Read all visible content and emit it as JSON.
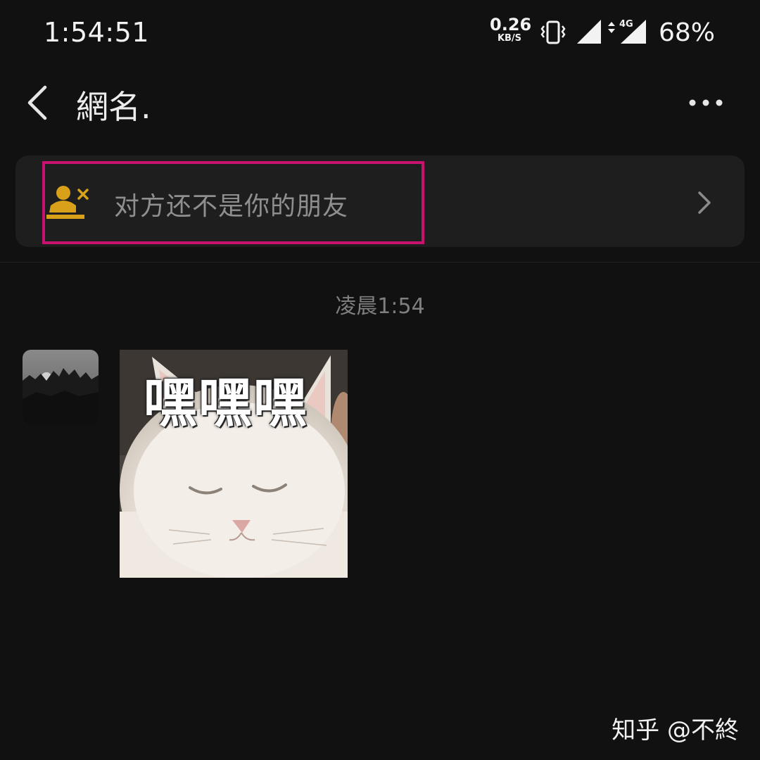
{
  "status_bar": {
    "time": "1:54:51",
    "net_speed_value": "0.26",
    "net_speed_unit": "KB/S",
    "network_type": "4G",
    "battery": "68%"
  },
  "header": {
    "title": "網名.",
    "back_icon": "chevron-left-icon",
    "more_icon": "more-horizontal-icon"
  },
  "banner": {
    "text": "对方还不是你的朋友",
    "icon": "user-x-icon",
    "icon_color": "#d9a01a",
    "highlight_color": "#c81270"
  },
  "chat": {
    "timestamp": "凌晨1:54",
    "messages": [
      {
        "type": "sticker",
        "sticker_text": "嘿嘿嘿"
      }
    ]
  },
  "watermark": "知乎 @不終"
}
